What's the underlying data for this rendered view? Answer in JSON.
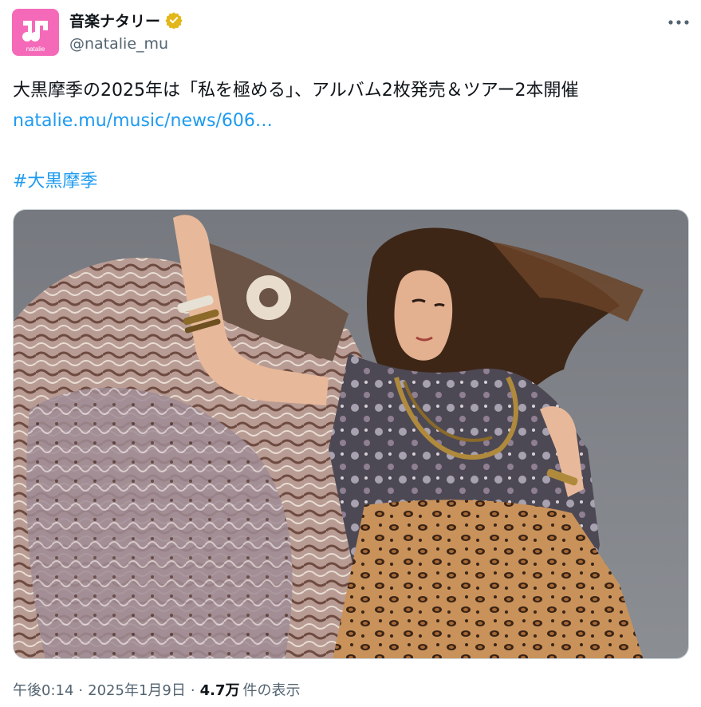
{
  "author": {
    "display_name": "音楽ナタリー",
    "handle": "@natalie_mu",
    "avatar_caption": "natalie",
    "verified_color": "#e2b719",
    "avatar_color": "#f46ab9"
  },
  "tweet": {
    "text": "大黒摩季の2025年は「私を極める」、アルバム2枚発売＆ツアー2本開催",
    "link": "natalie.mu/music/news/606…",
    "hashtag": "#大黒摩季"
  },
  "meta": {
    "time": "午後0:14",
    "separator": "·",
    "date": "2025年1月9日",
    "views": "4.7万",
    "views_label": "件の表示"
  },
  "colors": {
    "link": "#1d9bf0",
    "secondary_text": "#536471",
    "primary_text": "#0f1419"
  },
  "icons": {
    "more": "more-horizontal-icon",
    "verified": "verified-badge-icon"
  }
}
